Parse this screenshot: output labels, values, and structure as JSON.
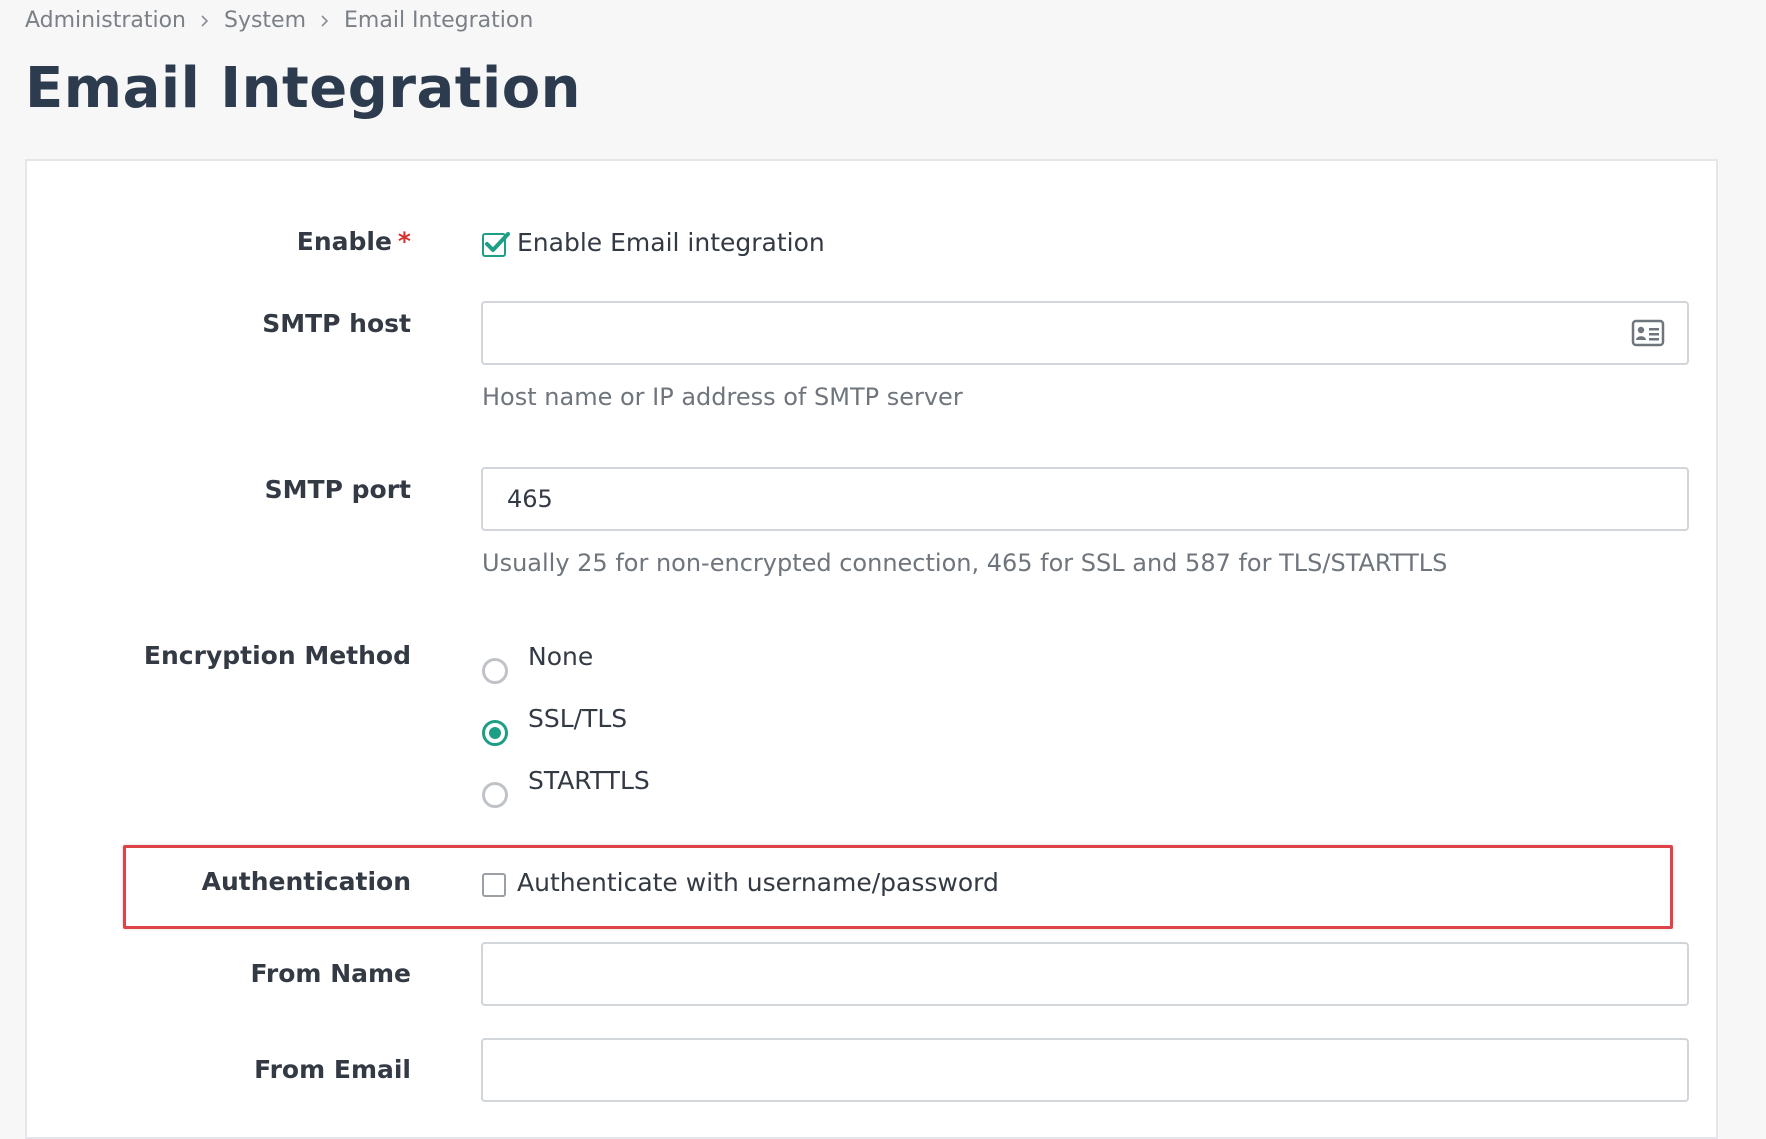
{
  "breadcrumb": {
    "items": [
      "Administration",
      "System",
      "Email Integration"
    ]
  },
  "page": {
    "title": "Email Integration"
  },
  "form": {
    "enable": {
      "label": "Enable",
      "required_mark": "*",
      "checkbox_label": "Enable Email integration",
      "checked": true
    },
    "smtp_host": {
      "label": "SMTP host",
      "value": "",
      "help": "Host name or IP address of SMTP server",
      "icon": "contact-card-icon"
    },
    "smtp_port": {
      "label": "SMTP port",
      "value": "465",
      "help": "Usually 25 for non-encrypted connection, 465 for SSL and 587 for TLS/STARTTLS"
    },
    "encryption": {
      "label": "Encryption Method",
      "options": [
        {
          "label": "None",
          "selected": false
        },
        {
          "label": "SSL/TLS",
          "selected": true
        },
        {
          "label": "STARTTLS",
          "selected": false
        }
      ]
    },
    "authentication": {
      "label": "Authentication",
      "checkbox_label": "Authenticate with username/password",
      "checked": false
    },
    "from_name": {
      "label": "From Name",
      "value": ""
    },
    "from_email": {
      "label": "From Email",
      "value": ""
    }
  },
  "colors": {
    "accent": "#1f9e86",
    "required": "#d9302c",
    "highlight": "#e0424a",
    "title": "#2c3b4d"
  }
}
